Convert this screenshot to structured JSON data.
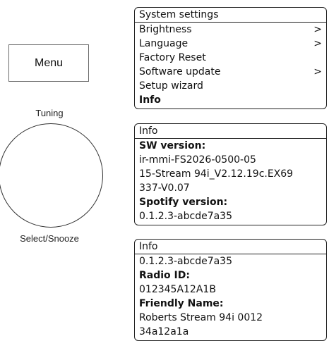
{
  "device": {
    "menu_label": "Menu",
    "tuning_label": "Tuning",
    "select_label": "Select/Snooze"
  },
  "screens": [
    {
      "header": "System settings",
      "rows": [
        {
          "text": "Brightness",
          "bold": false,
          "arrow": ">"
        },
        {
          "text": "Language",
          "bold": false,
          "arrow": ">"
        },
        {
          "text": "Factory Reset",
          "bold": false,
          "arrow": ""
        },
        {
          "text": "Software update",
          "bold": false,
          "arrow": ">"
        },
        {
          "text": "Setup wizard",
          "bold": false,
          "arrow": ""
        },
        {
          "text": "Info",
          "bold": true,
          "arrow": ""
        }
      ]
    },
    {
      "header": "Info",
      "rows": [
        {
          "text": "SW version:",
          "bold": true,
          "arrow": ""
        },
        {
          "text": "ir-mmi-FS2026-0500-05",
          "bold": false,
          "arrow": ""
        },
        {
          "text": "15-Stream 94i_V2.12.19c.EX69",
          "bold": false,
          "arrow": ""
        },
        {
          "text": "337-V0.07",
          "bold": false,
          "arrow": ""
        },
        {
          "text": "Spotify version:",
          "bold": true,
          "arrow": ""
        },
        {
          "text": "0.1.2.3-abcde7a35",
          "bold": false,
          "arrow": ""
        }
      ]
    },
    {
      "header": "Info",
      "rows": [
        {
          "text": "0.1.2.3-abcde7a35",
          "bold": false,
          "arrow": ""
        },
        {
          "text": "Radio ID:",
          "bold": true,
          "arrow": ""
        },
        {
          "text": "012345A12A1B",
          "bold": false,
          "arrow": ""
        },
        {
          "text": "Friendly Name:",
          "bold": true,
          "arrow": ""
        },
        {
          "text": "Roberts Stream 94i 0012",
          "bold": false,
          "arrow": ""
        },
        {
          "text": "34a12a1a",
          "bold": false,
          "arrow": ""
        }
      ]
    }
  ]
}
